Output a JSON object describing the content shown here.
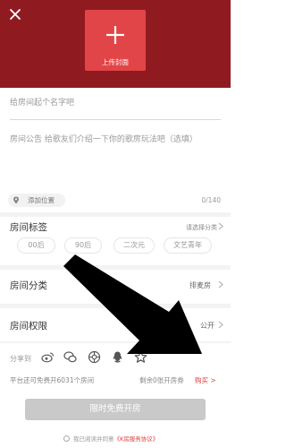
{
  "header": {
    "close_icon": "close-icon",
    "cover_label": "上传封面",
    "cover_icon": "plus-icon"
  },
  "form": {
    "name_placeholder": "给房间起个名字吧",
    "notice_placeholder": "房间公告 给歌友们介绍一下你的歌房玩法吧（选填）",
    "location_label": "添加位置",
    "location_icon": "location-pin-icon",
    "counter": "0/140"
  },
  "sections": {
    "tags": {
      "title": "房间标签",
      "hint": "请选择分类",
      "items": [
        "00后",
        "90后",
        "二次元",
        "文艺青年"
      ]
    },
    "category": {
      "title": "房间分类",
      "value": "排麦房"
    },
    "permission": {
      "title": "房间权限",
      "value": "公开"
    }
  },
  "share": {
    "label": "分享到",
    "icons": [
      "weibo-icon",
      "wechat-icon",
      "moments-icon",
      "qq-icon",
      "qzone-star-icon"
    ]
  },
  "quota": {
    "left": "平台还可免费开6031个房间",
    "right": "剩余0张开房券",
    "buy": "购买 >"
  },
  "action": {
    "open_label": "限时免费开房"
  },
  "agreement": {
    "text": "我已阅读并同意",
    "link": "《K房服务协议》"
  },
  "colors": {
    "header": "#8f1b21",
    "cover": "#e24547",
    "accent": "#e33a3a",
    "button_disabled": "#c9c9c9"
  }
}
